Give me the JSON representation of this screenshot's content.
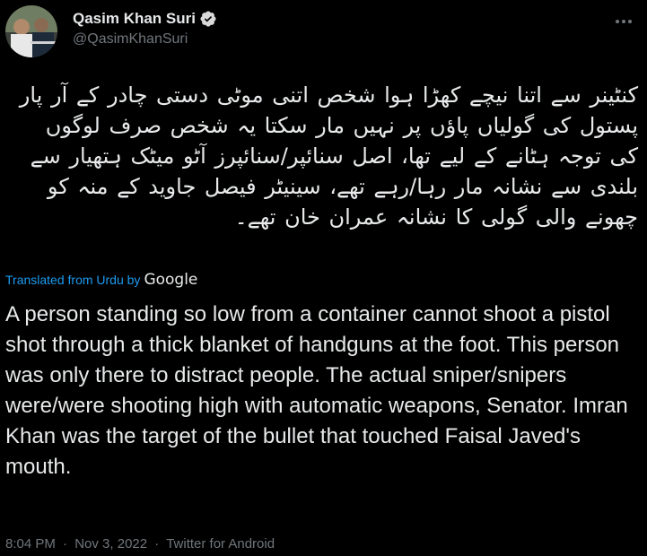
{
  "author": {
    "display_name": "Qasim Khan Suri",
    "handle": "@QasimKhanSuri",
    "verified": true,
    "avatar_icon": "profile-photo"
  },
  "tweet": {
    "urdu_text": "کنٹینر سے اتنا نیچے کھڑا ہوا شخص اتنی موٹی دستی چادر کے آر پار پستول کی گولیاں پاؤں پر نہیں مار سکتا یہ شخص صرف لوگوں کی توجہ ہٹانے کے لیے تھا، اصل سنائپر/سنائپرز آٹو میٹک ہتھیار سے بلندی سے نشانہ مار رہا/رہے تھے، سینیٹر فیصل جاوید کے منہ کو چھونے والی گولی کا نشانہ عمران خان تھے۔",
    "translated_label": "Translated from Urdu by",
    "translator_name": "Google",
    "translation_text": "A person standing so low from a container cannot shoot a pistol shot through a thick blanket of handguns at the foot. This person was only there to distract people. The actual sniper/snipers were/were shooting high with automatic weapons, Senator. Imran Khan was the target of the bullet that touched Faisal Javed's mouth."
  },
  "meta": {
    "time": "8:04 PM",
    "separator": "·",
    "date": "Nov 3, 2022",
    "source": "Twitter for Android"
  },
  "icons": {
    "verified": "verified-badge-icon",
    "more": "more-options-icon"
  },
  "colors": {
    "background": "#000000",
    "text": "#e7e9ea",
    "secondary": "#71767b",
    "link": "#1d9bf0"
  }
}
